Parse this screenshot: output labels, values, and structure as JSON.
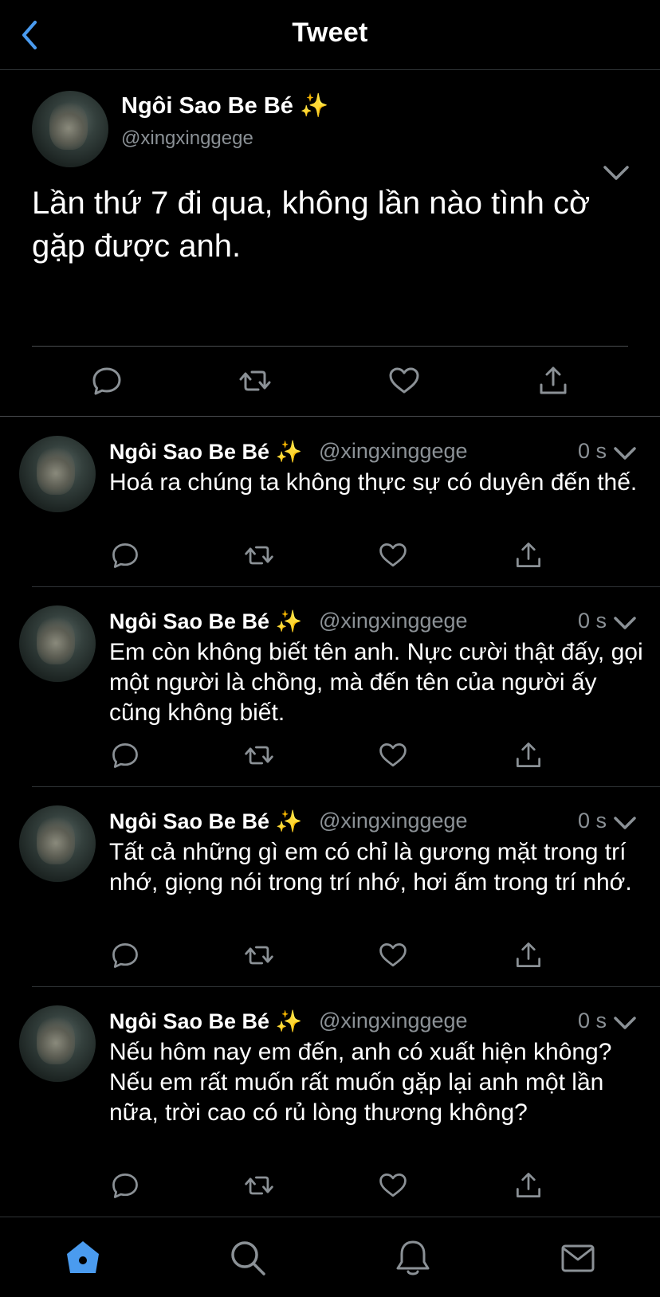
{
  "header": {
    "title": "Tweet"
  },
  "colors": {
    "accent": "#4a9bef",
    "muted": "#8b9196",
    "icon": "#8b9196"
  },
  "main_tweet": {
    "author_name": "Ngôi Sao Be Bé ✨",
    "author_handle": "@xingxinggege",
    "text": "Lần thứ 7 đi qua, không lần nào tình cờ gặp được anh."
  },
  "replies": [
    {
      "author_name": "Ngôi Sao Be Bé ✨",
      "author_handle": "@xingxinggege",
      "time": "0 s",
      "text": "Hoá ra chúng ta không thực sự có duyên đến thế."
    },
    {
      "author_name": "Ngôi Sao Be Bé ✨",
      "author_handle": "@xingxinggege",
      "time": "0 s",
      "text": "Em còn không biết tên anh. Nực cười thật đấy, gọi một người là chồng, mà đến tên của người ấy cũng không biết."
    },
    {
      "author_name": "Ngôi Sao Be Bé ✨",
      "author_handle": "@xingxinggege",
      "time": "0 s",
      "text": "Tất cả những gì em có chỉ là gương mặt trong trí nhớ, giọng nói trong trí nhớ, hơi ấm trong trí nhớ."
    },
    {
      "author_name": "Ngôi Sao Be Bé ✨",
      "author_handle": "@xingxinggege",
      "time": "0 s",
      "text": "Nếu hôm nay em đến, anh có xuất hiện không? Nếu em rất muốn rất muốn gặp lại anh một lần nữa, trời cao có rủ lòng thương không?"
    }
  ],
  "tabbar": {
    "items": [
      "home-icon",
      "search-icon",
      "notifications-icon",
      "messages-icon"
    ],
    "active": "home-icon"
  }
}
